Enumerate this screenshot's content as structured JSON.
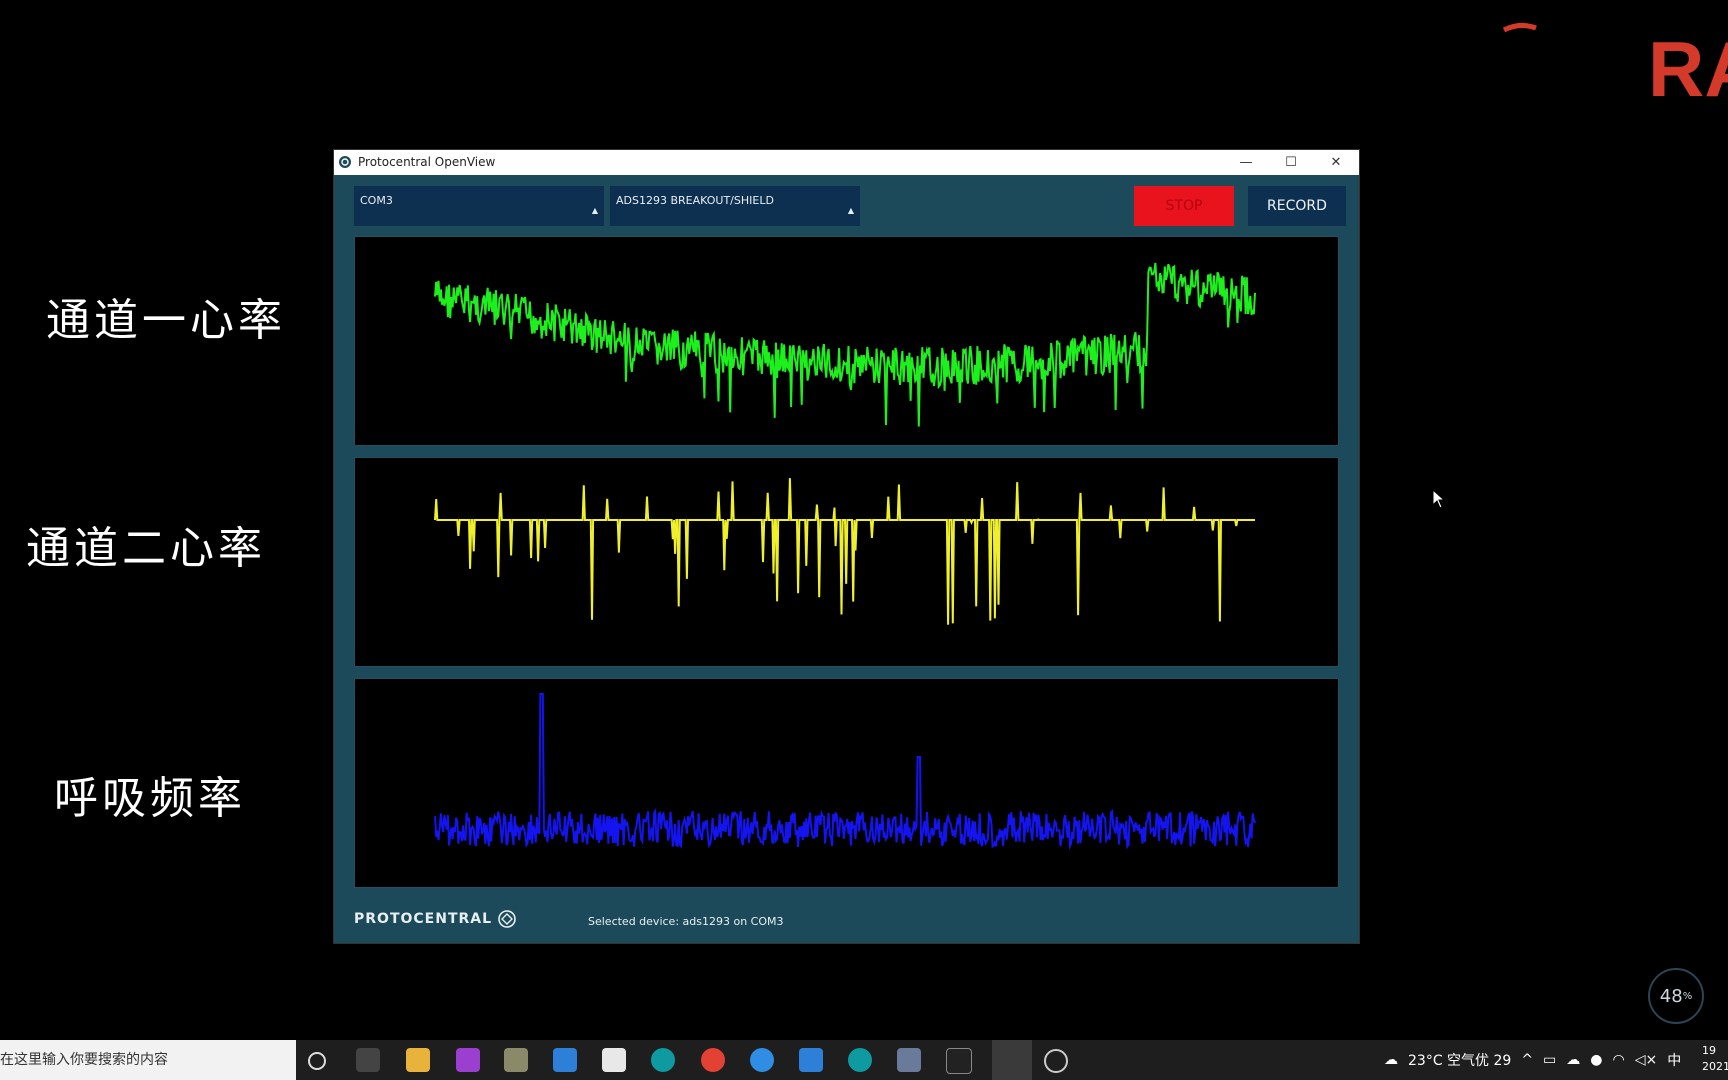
{
  "captions": [
    "通道一心率",
    "通道二心率",
    "呼吸频率"
  ],
  "brand_fragment": "RA",
  "window": {
    "title": "Protocentral OpenView",
    "port_select": "COM3",
    "board_select": "ADS1293 BREAKOUT/SHIELD",
    "stop_label": "STOP",
    "record_label": "RECORD",
    "footer_logo": "PROTOCENTRAL",
    "status": "Selected device: ads1293 on COM3"
  },
  "plots": {
    "ch1_color": "#1ef01e",
    "ch2_color": "#f0f02a",
    "resp_color": "#1414f0"
  },
  "cpu_ring": {
    "value": "48",
    "unit": "%"
  },
  "taskbar": {
    "search_placeholder": "在这里输入你要搜索的内容",
    "weather": "23°C 空气优 29",
    "ime": "中",
    "clock_time": "19",
    "clock_date": "2021"
  }
}
